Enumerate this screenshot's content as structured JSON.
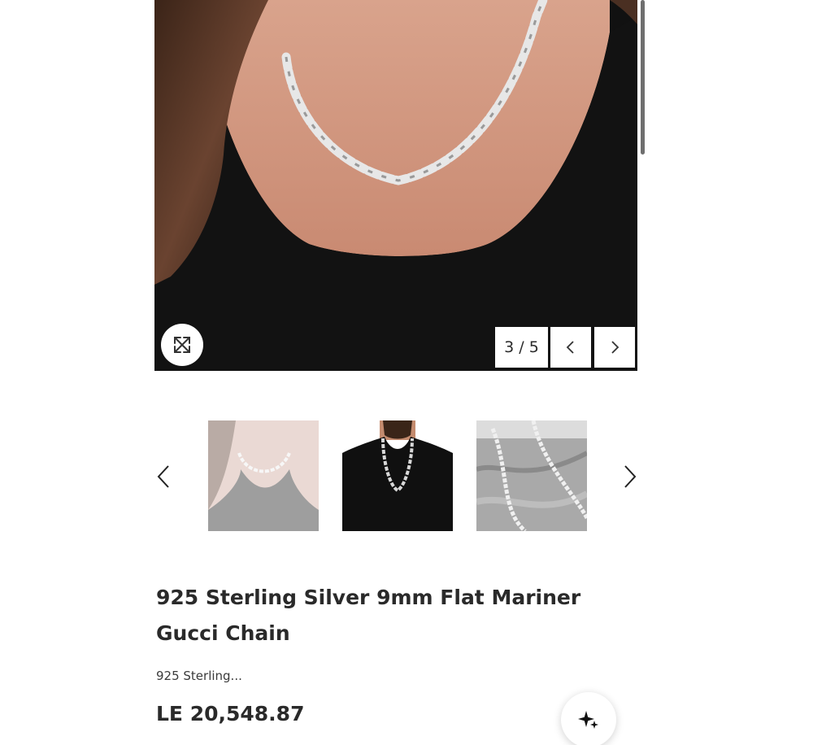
{
  "gallery": {
    "current_index": 3,
    "total": 5,
    "counter_text": "3 / 5",
    "main_image": "model-wearing-silver-mariner-chain",
    "thumbnails": [
      {
        "subject": "woman-wearing-chain",
        "selected": false
      },
      {
        "subject": "man-wearing-chain",
        "selected": false
      },
      {
        "subject": "chain-on-marble",
        "selected": false
      }
    ]
  },
  "product": {
    "title": "925 Sterling Silver 9mm Flat Mariner Gucci Chain",
    "subtitle": "925 Sterling...",
    "price": "LE 20,548.87"
  },
  "icons": {
    "zoom": "expand-icon",
    "prev": "chevron-left-icon",
    "next": "chevron-right-icon",
    "ai": "sparkles-icon"
  },
  "colors": {
    "text": "#2a2a2a",
    "background": "#ffffff",
    "image_dark": "#0f0f0f"
  }
}
